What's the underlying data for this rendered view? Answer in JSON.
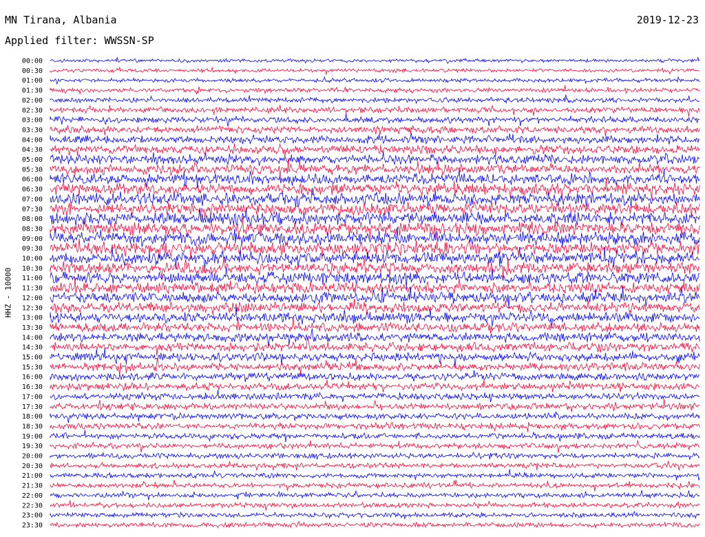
{
  "header": {
    "station": "MN Tirana, Albania",
    "date": "2019-12-23",
    "filter": "Applied filter: WWSSN-SP"
  },
  "chart_data": {
    "type": "line",
    "title": "MN Tirana, Albania",
    "ylabel": "HHZ - 10000",
    "row_labels": [
      "00:00",
      "00:30",
      "01:00",
      "01:30",
      "02:00",
      "02:30",
      "03:00",
      "03:30",
      "04:00",
      "04:30",
      "05:00",
      "05:30",
      "06:00",
      "06:30",
      "07:00",
      "07:30",
      "08:00",
      "08:30",
      "09:00",
      "09:30",
      "10:00",
      "10:30",
      "11:00",
      "11:30",
      "12:00",
      "12:30",
      "13:00",
      "13:30",
      "14:00",
      "14:30",
      "15:00",
      "15:30",
      "16:00",
      "16:30",
      "17:00",
      "17:30",
      "18:00",
      "18:30",
      "19:00",
      "19:30",
      "20:00",
      "20:30",
      "21:00",
      "21:30",
      "22:00",
      "22:30",
      "23:00",
      "23:30"
    ],
    "trace_colors": [
      "#0000ff",
      "#ff0033"
    ],
    "noise_profile": [
      2.2,
      2.3,
      2.5,
      2.8,
      3.2,
      3.6,
      4.0,
      4.5,
      5.0,
      5.5,
      6.0,
      6.4,
      6.8,
      7.2,
      7.5,
      7.8,
      8.0,
      8.0,
      8.0,
      7.8,
      7.6,
      7.4,
      7.2,
      7.0,
      6.8,
      6.5,
      6.2,
      6.0,
      5.8,
      5.5,
      5.2,
      5.0,
      4.8,
      4.6,
      4.4,
      4.2,
      4.0,
      3.8,
      3.6,
      3.5,
      3.4,
      3.3,
      3.2,
      3.1,
      3.0,
      3.0,
      3.0,
      3.0
    ],
    "grid": false
  }
}
